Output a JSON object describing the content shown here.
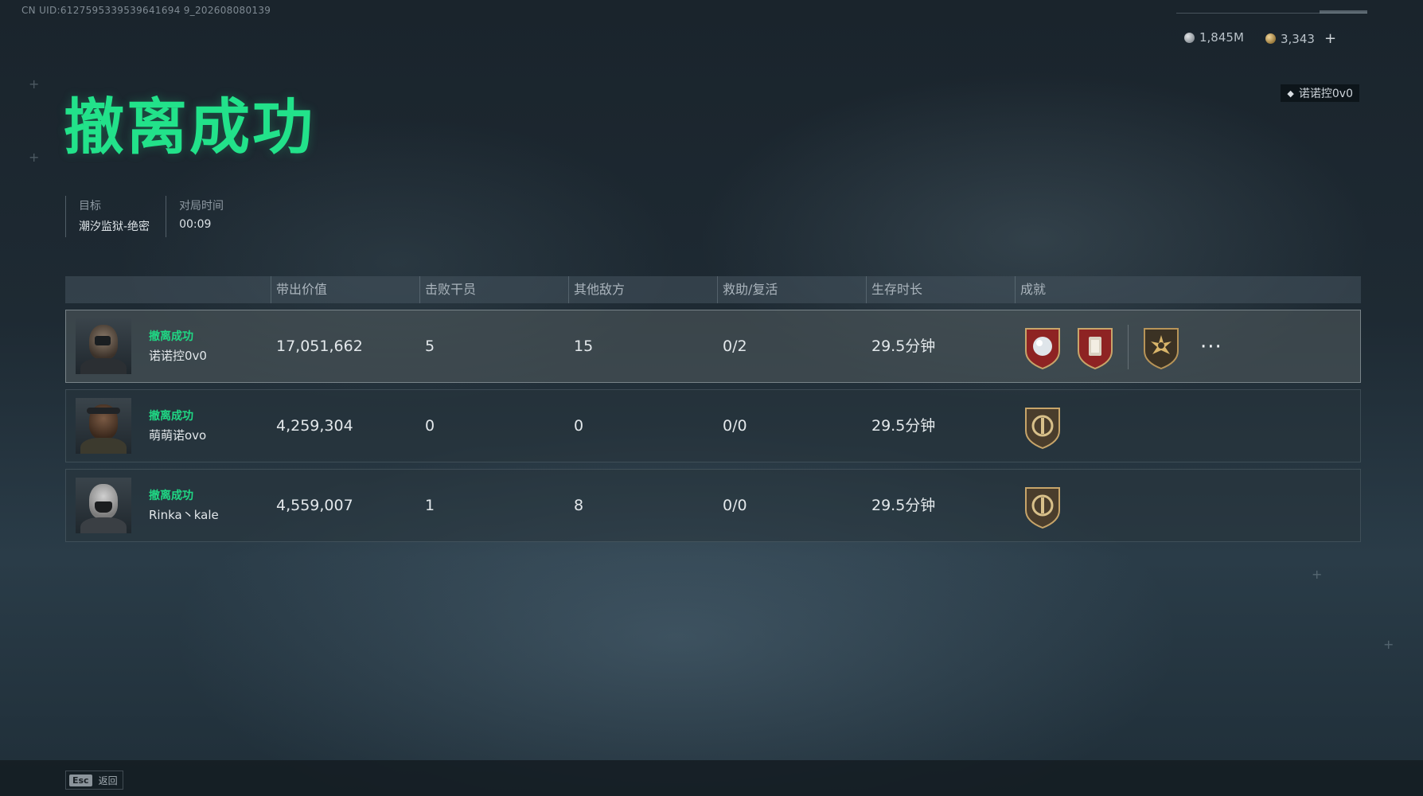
{
  "uid_text": "CN UID:6127595339539641694 9_202608080139",
  "currencies": [
    {
      "icon": "silver-coin-icon",
      "value": "1,845M"
    },
    {
      "icon": "gold-coin-icon",
      "value": "3,343",
      "add": "+"
    }
  ],
  "user_chip": {
    "icon": "player-icon",
    "name": "诺诺控0v0"
  },
  "title": "撤离成功",
  "meta": [
    {
      "label": "目标",
      "value": "潮汐监狱-绝密"
    },
    {
      "label": "对局时间",
      "value": "00:09"
    }
  ],
  "table": {
    "columns": [
      "带出价值",
      "击败干员",
      "其他敌方",
      "救助/复活",
      "生存时长",
      "成就"
    ],
    "rows": [
      {
        "status": "撤离成功",
        "name": "诺诺控0v0",
        "value": "17,051,662",
        "kills": "5",
        "other": "15",
        "assist": "0/2",
        "survival": "29.5分钟",
        "badges": [
          "diamond-shield-badge-icon",
          "lantern-shield-badge-icon",
          "sun-emblem-badge-icon"
        ],
        "more": "···"
      },
      {
        "status": "撤离成功",
        "name": "萌萌诺ovo",
        "value": "4,259,304",
        "kills": "0",
        "other": "0",
        "assist": "0/0",
        "survival": "29.5分钟",
        "badges": [
          "extraction-emblem-badge-icon"
        ]
      },
      {
        "status": "撤离成功",
        "name": "Rinka丶kale",
        "value": "4,559,007",
        "kills": "1",
        "other": "8",
        "assist": "0/0",
        "survival": "29.5分钟",
        "badges": [
          "extraction-emblem-badge-icon"
        ]
      }
    ]
  },
  "footer": {
    "key": "Esc",
    "label": "返回"
  },
  "colors": {
    "accent_green": "#22e28a",
    "badge_red": "#9b2a2a",
    "badge_gold": "#b08a4a"
  }
}
